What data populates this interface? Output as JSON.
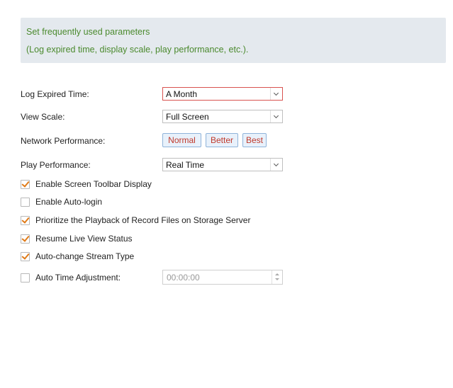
{
  "info": {
    "line1": "Set frequently used parameters",
    "line2": "(Log expired time, display scale, play performance, etc.)."
  },
  "settings": {
    "log_expired_label": "Log Expired Time:",
    "log_expired_value": "A Month",
    "view_scale_label": "View Scale:",
    "view_scale_value": "Full Screen",
    "network_perf_label": "Network Performance:",
    "network_perf_options": [
      "Normal",
      "Better",
      "Best"
    ],
    "play_perf_label": "Play Performance:",
    "play_perf_value": "Real Time"
  },
  "checkboxes": [
    {
      "label": "Enable Screen Toolbar Display",
      "checked": true
    },
    {
      "label": "Enable Auto-login",
      "checked": false
    },
    {
      "label": "Prioritize the Playback of Record Files on Storage Server",
      "checked": true
    },
    {
      "label": "Resume Live View Status",
      "checked": true
    },
    {
      "label": "Auto-change Stream Type",
      "checked": true
    },
    {
      "label": "Auto Time Adjustment:",
      "checked": false
    }
  ],
  "time_adjust": {
    "value": "00:00:00"
  },
  "colors": {
    "info_text": "#4b8a2e",
    "info_bg": "#e4e9ee",
    "check_tick": "#e07b18",
    "button_text": "#c0392b",
    "active_border": "#d9534f"
  }
}
